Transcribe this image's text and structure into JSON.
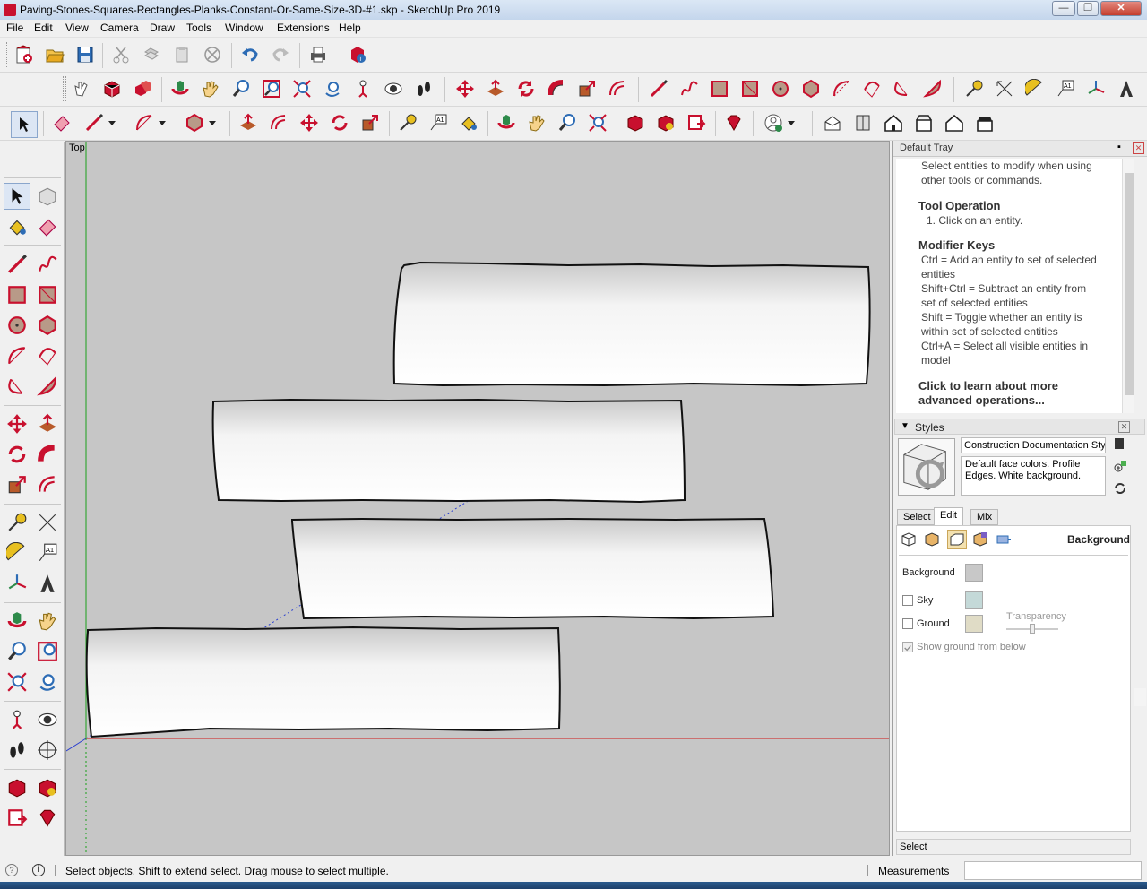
{
  "window": {
    "title": "Paving-Stones-Squares-Rectangles-Planks-Constant-Or-Same-Size-3D-#1.skp - SketchUp Pro 2019",
    "minimize": "—",
    "maximize": "❐",
    "close": "✕"
  },
  "menu": {
    "items": [
      "File",
      "Edit",
      "View",
      "Camera",
      "Draw",
      "Tools",
      "Window",
      "Extensions",
      "Help"
    ]
  },
  "viewport": {
    "view_label": "Top"
  },
  "tray": {
    "title": "Default Tray",
    "pin": "▪",
    "close": "✕",
    "instructor": {
      "intro": "Select entities to modify when using other tools or commands.",
      "tool_operation_heading": "Tool Operation",
      "tool_operation_step": "1. Click on an entity.",
      "modifier_keys_heading": "Modifier Keys",
      "modifier_keys": [
        "Ctrl = Add an entity to set of selected entities",
        "Shift+Ctrl = Subtract an entity from set of selected entities",
        "Shift = Toggle whether an entity is within set of selected entities",
        "Ctrl+A = Select all visible entities in model"
      ],
      "learn_more": "Click to learn about more advanced operations..."
    },
    "styles": {
      "title": "Styles",
      "style_name": "Construction Documentation Sty",
      "style_description": "Default face colors. Profile Edges. White background.",
      "tabs": [
        "Select",
        "Edit",
        "Mix"
      ],
      "active_tab": "Edit",
      "section_label": "Background",
      "background_label": "Background",
      "sky_label": "Sky",
      "ground_label": "Ground",
      "transparency_label": "Transparency",
      "show_ground_label": "Show ground from below",
      "colors": {
        "background": "#c8c8c8",
        "sky": "#c4d9d8",
        "ground": "#e0dcc6"
      }
    },
    "bottom_label": "Select"
  },
  "status": {
    "message": "Select objects. Shift to extend select. Drag mouse to select multiple.",
    "measurements_label": "Measurements",
    "measurements_value": ""
  },
  "icons": {
    "select": "arrow-select-icon",
    "eraser": "eraser-icon",
    "pencil": "line-icon"
  }
}
